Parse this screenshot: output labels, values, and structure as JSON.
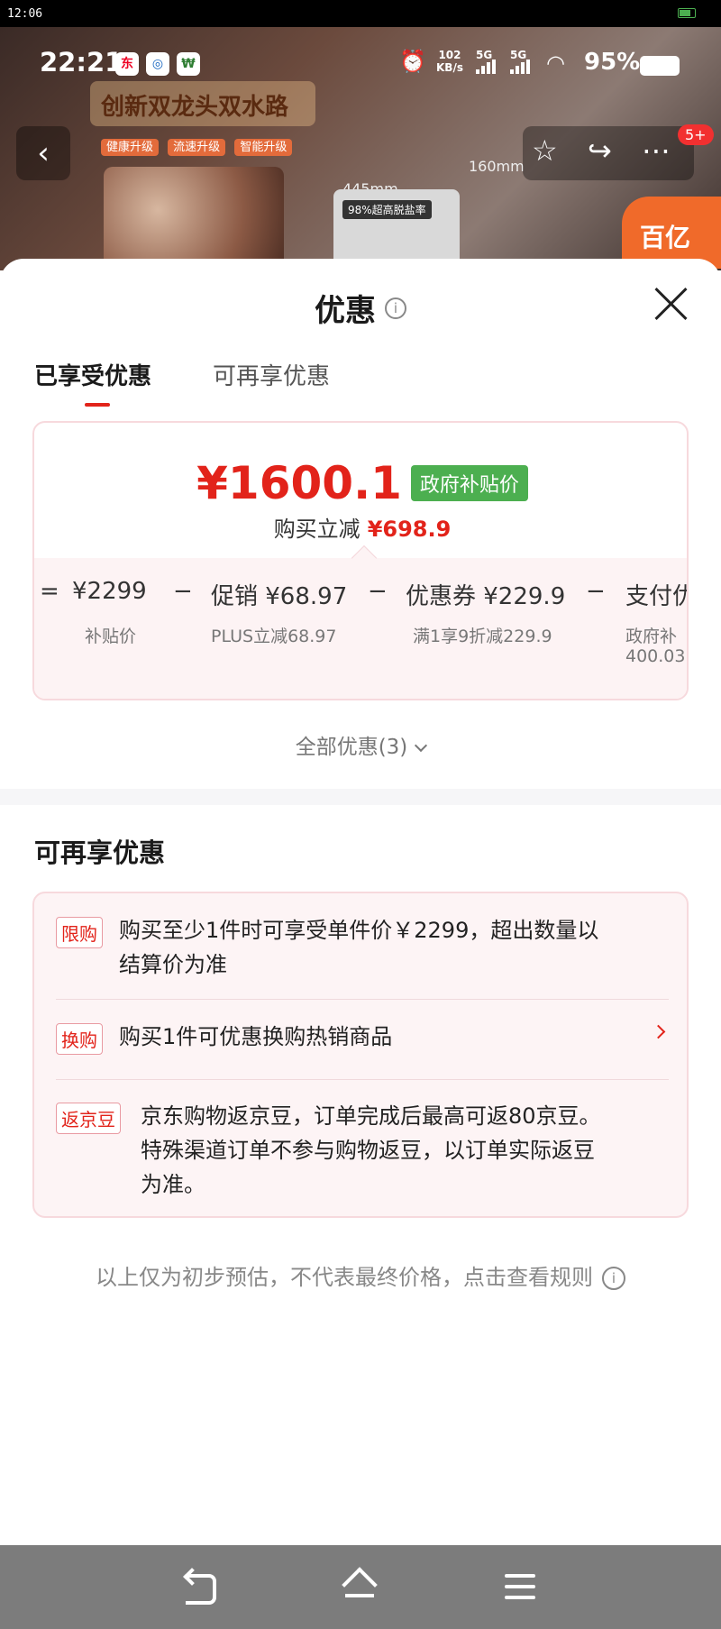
{
  "outer_status": {
    "time": "12:06"
  },
  "status": {
    "time": "22:21",
    "net_rate_value": "102",
    "net_rate_unit": "KB/s",
    "sim1": "5G",
    "sim2": "5G",
    "battery_pct": "95%"
  },
  "background": {
    "banner": "创新双龙头双水路",
    "chips": [
      "健康升级",
      "流速升级",
      "智能升级"
    ],
    "dim_a": "445mm",
    "dim_b": "160mm",
    "machine_label": "98%超高脱盐率",
    "corner_text": "百亿"
  },
  "nav": {
    "badge": "5+"
  },
  "sheet": {
    "title": "优惠",
    "tabs": [
      {
        "label": "已享受优惠",
        "active": true
      },
      {
        "label": "可再享优惠",
        "active": false
      }
    ],
    "price_card": {
      "price": "¥1600.1",
      "badge": "政府补贴价",
      "reduce_label": "购买立减",
      "reduce_amount": "¥698.9",
      "breakdown": [
        {
          "op": "=",
          "label": "¥2299",
          "sub": "补贴价"
        },
        {
          "op": "−",
          "label": "促销 ¥68.97",
          "sub": "PLUS立减68.97"
        },
        {
          "op": "−",
          "label": "优惠券 ¥229.9",
          "sub": "满1享9折减229.9"
        },
        {
          "op": "−",
          "label": "支付优",
          "sub": "政府补",
          "sub2": "400.03"
        }
      ]
    },
    "all_deals": "全部优惠(3)",
    "more_title": "可再享优惠",
    "more_items": [
      {
        "tag": "限购",
        "text_line1": "购买至少1件时可享受单件价￥2299，超出数量以",
        "text_line2": "结算价为准"
      },
      {
        "tag": "换购",
        "text_line1": "购买1件可优惠换购热销商品"
      },
      {
        "tag": "返京豆",
        "text_line1": "京东购物返京豆，订单完成后最高可返80京豆。",
        "text_line2": "特殊渠道订单不参与购物返豆，以订单实际返豆",
        "text_line3": "为准。"
      }
    ],
    "disclaimer": "以上仅为初步预估，不代表最终价格，点击查看规则"
  },
  "colors": {
    "accent": "#e2231a",
    "gov_badge": "#4caf50",
    "card_border": "#f7d9dd"
  }
}
